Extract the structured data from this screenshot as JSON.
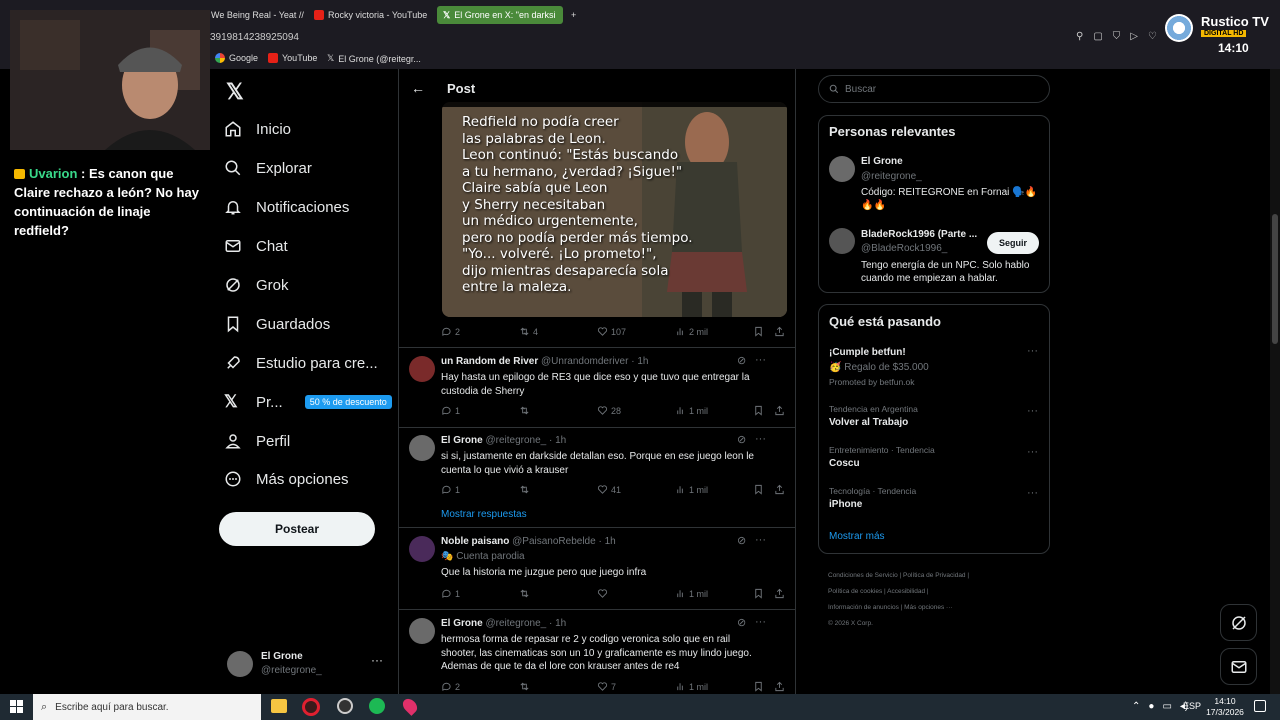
{
  "browser": {
    "tabs": [
      {
        "label": "We Being Real - Yeat //"
      },
      {
        "label": "Rocky victoria - YouTube"
      },
      {
        "label": "El Grone en X: \"en darksi"
      }
    ],
    "url_fragment": "3919814238925094",
    "bookmarks": [
      "Google",
      "YouTube",
      "El Grone (@reitegr..."
    ]
  },
  "stream": {
    "chat_user": "Uvarion",
    "chat_text": " : Es canon que Claire rechazo a león? No hay continuación de linaje redfield?",
    "logo_name": "Rustico TV",
    "logo_badge": "DIGITAL HD",
    "logo_time": "14:10"
  },
  "nav": {
    "items": [
      {
        "label": "Inicio",
        "icon": "home-icon"
      },
      {
        "label": "Explorar",
        "icon": "search-icon"
      },
      {
        "label": "Notificaciones",
        "icon": "bell-icon"
      },
      {
        "label": "Chat",
        "icon": "mail-icon"
      },
      {
        "label": "Grok",
        "icon": "grok-icon"
      },
      {
        "label": "Guardados",
        "icon": "bookmark-icon"
      },
      {
        "label": "Estudio para cre...",
        "icon": "rocket-icon"
      },
      {
        "label": "Pr...",
        "icon": "x-premium-icon"
      },
      {
        "label": "Perfil",
        "icon": "person-icon"
      },
      {
        "label": "Más opciones",
        "icon": "more-circle-icon"
      }
    ],
    "promo_badge": "50 % de descuento",
    "post_button": "Postear",
    "account_name": "El Grone",
    "account_handle": "@reitegrone_"
  },
  "post": {
    "header": "Post",
    "image_text": "Redfield no podía creer\nlas palabras de Leon.\nLeon continuó: \"Estás buscando\na tu hermano, ¿verdad? ¡Sigue!\"\nClaire sabía que Leon\ny Sherry necesitaban\nun médico urgentemente,\npero no podía perder más tiempo.\n\"Yo... volveré. ¡Lo prometo!\",\ndijo mientras desaparecía sola\nentre la maleza.",
    "stats": {
      "replies": "2",
      "reposts": "4",
      "likes": "107",
      "views": "2 mil"
    }
  },
  "replies": [
    {
      "name": "un Random de River",
      "handle": "@Unrandomderiver",
      "time": "· 1h",
      "text": "Hay hasta un epilogo de RE3 que dice eso y que tuvo que entregar la custodia de Sherry",
      "replies": "1",
      "reposts": "",
      "likes": "28",
      "views": "1 mil",
      "avatar_color": "#7a2a2a"
    },
    {
      "name": "El Grone",
      "handle": "@reitegrone_",
      "time": "· 1h",
      "text": "si si, justamente en darkside detallan eso. Porque en ese juego leon le cuenta lo que vivió a krauser",
      "replies": "1",
      "reposts": "",
      "likes": "41",
      "views": "1 mil",
      "avatar_color": "#6a6a6a",
      "show_replies": "Mostrar respuestas"
    },
    {
      "name": "Noble paisano",
      "handle": "@PaisanoRebelde",
      "time": "· 1h",
      "badge": "Cuenta parodia",
      "text": "Que la historia me juzgue pero que juego infra",
      "replies": "1",
      "reposts": "",
      "likes": "",
      "views": "1 mil",
      "avatar_color": "#4a2a5a"
    },
    {
      "name": "El Grone",
      "handle": "@reitegrone_",
      "time": "· 1h",
      "text": "hermosa forma de repasar re 2 y codigo veronica solo que en rail shooter, las cinematicas son un 10 y graficamente es muy lindo juego. Ademas de que te da el lore con krauser antes de re4",
      "replies": "2",
      "reposts": "",
      "likes": "7",
      "views": "1 mil",
      "avatar_color": "#6a6a6a"
    }
  ],
  "sidebar": {
    "search_placeholder": "Buscar",
    "people_title": "Personas relevantes",
    "people": [
      {
        "name": "El Grone",
        "handle": "@reitegrone_",
        "bio": "Código: REITEGRONE en Fornai 🗣️🔥🔥🔥"
      },
      {
        "name": "BladeRock1996 (Parte ...",
        "handle": "@BladeRock1996_",
        "bio": "Tengo energía de un NPC. Solo hablo cuando me empiezan a hablar.",
        "follow": "Seguir"
      }
    ],
    "trends_title": "Qué está pasando",
    "trends": [
      {
        "name": "¡Cumple betfun!",
        "sub": "🥳 Regalo de $35.000",
        "meta": "Promoted by betfun.ok"
      },
      {
        "meta": "Tendencia en Argentina",
        "name": "Volver al Trabajo"
      },
      {
        "meta": "Entretenimiento · Tendencia",
        "name": "Coscu"
      },
      {
        "meta": "Tecnología · Tendencia",
        "name": "iPhone"
      }
    ],
    "show_more": "Mostrar más",
    "footer": [
      "Condiciones de Servicio",
      "Política de Privacidad",
      "Política de cookies",
      "Accesibilidad",
      "Información de anuncios",
      "Más opciones ···",
      "© 2026 X Corp."
    ]
  },
  "taskbar": {
    "search_placeholder": "Escribe aquí para buscar.",
    "lang": "ESP",
    "time": "14:10",
    "date": "17/3/2026"
  }
}
